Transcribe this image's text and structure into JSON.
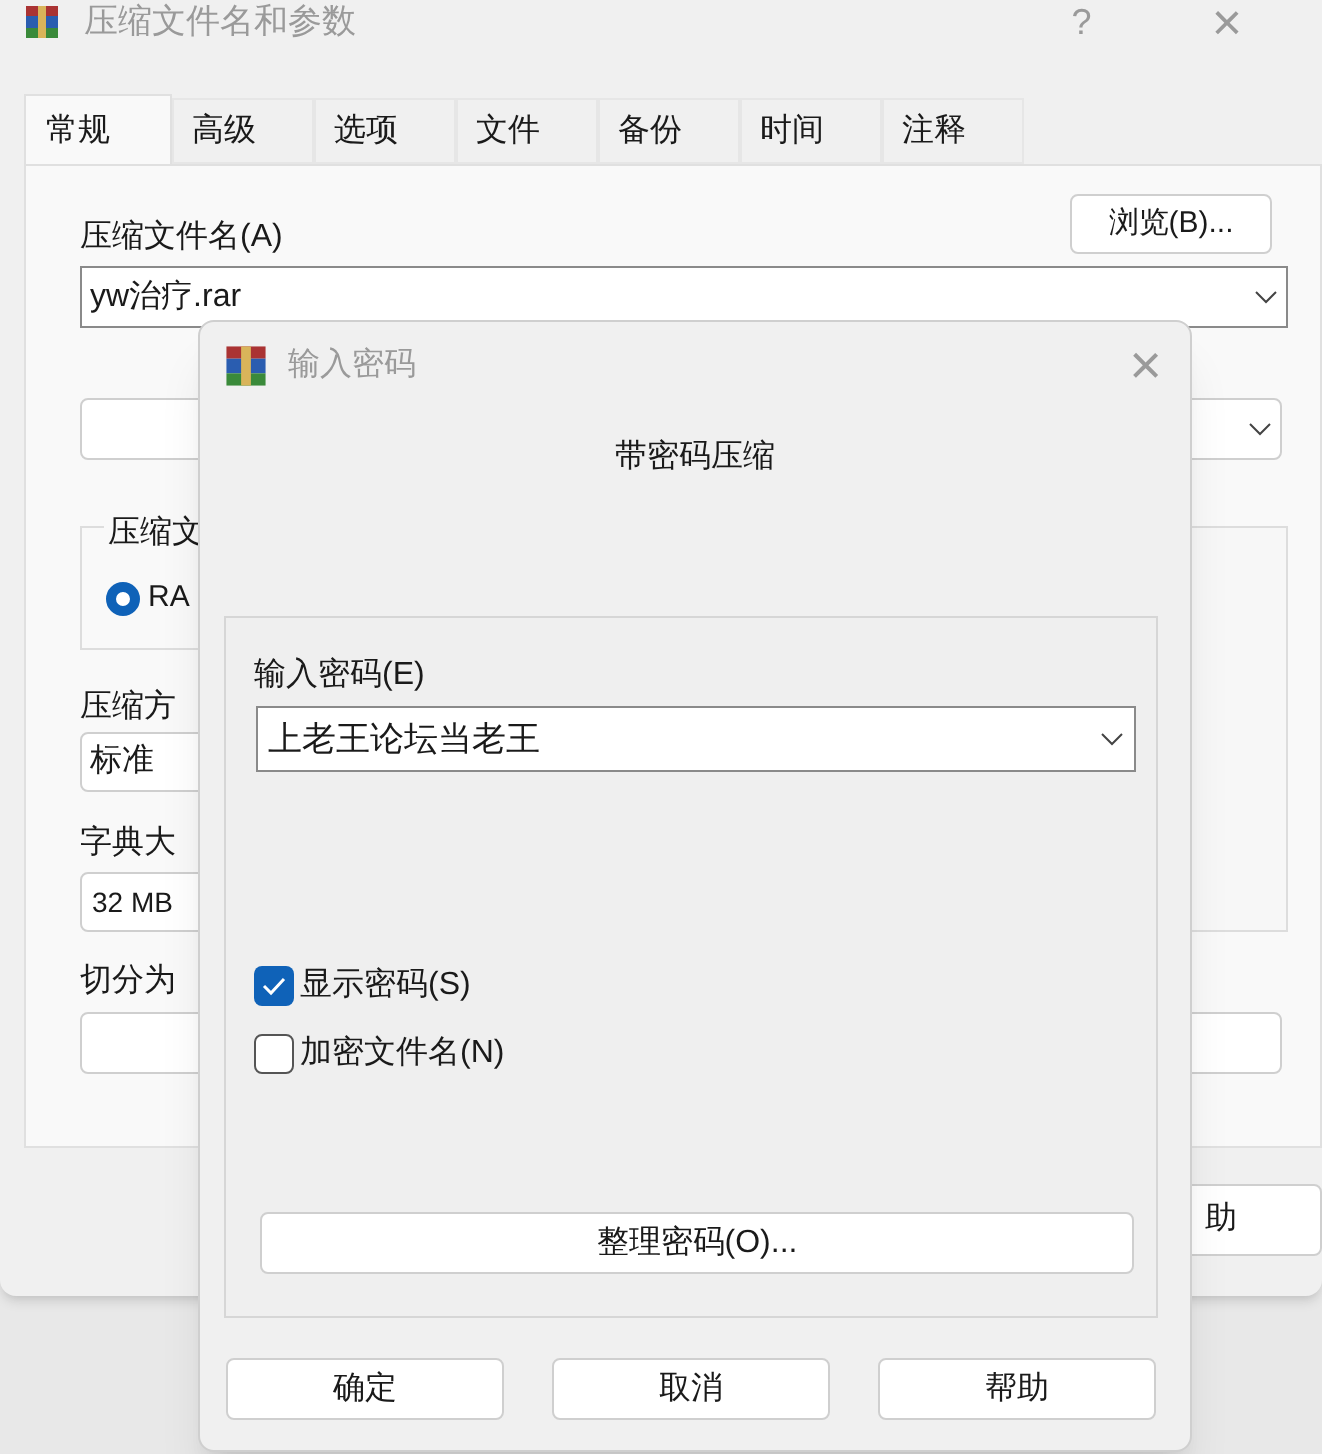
{
  "main_window": {
    "title": "压缩文件名和参数",
    "help_glyph": "?",
    "close_glyph": "×",
    "tabs": [
      {
        "label": "常规",
        "selected": true
      },
      {
        "label": "高级",
        "selected": false
      },
      {
        "label": "选项",
        "selected": false
      },
      {
        "label": "文件",
        "selected": false
      },
      {
        "label": "备份",
        "selected": false
      },
      {
        "label": "时间",
        "selected": false
      },
      {
        "label": "注释",
        "selected": false
      }
    ],
    "archive_name_label": "压缩文件名(A)",
    "browse_button": "浏览(B)...",
    "archive_name_value": "yw治疗.rar",
    "format_group_label": "压缩文",
    "format_radio": {
      "label": "RA",
      "selected": true
    },
    "method_label": "压缩方",
    "method_value": "标准",
    "dictionary_label": "字典大",
    "dictionary_value": "32 MB",
    "split_label": "切分为",
    "help_button": "助"
  },
  "password_dialog": {
    "title": "输入密码",
    "close_glyph": "×",
    "heading": "带密码压缩",
    "password_label": "输入密码(E)",
    "password_value": "上老王论坛当老王",
    "options": [
      {
        "label": "显示密码(S)",
        "checked": true
      },
      {
        "label": "加密文件名(N)",
        "checked": false
      }
    ],
    "organize_button": "整理密码(O)...",
    "buttons": [
      "确定",
      "取消",
      "帮助"
    ]
  }
}
